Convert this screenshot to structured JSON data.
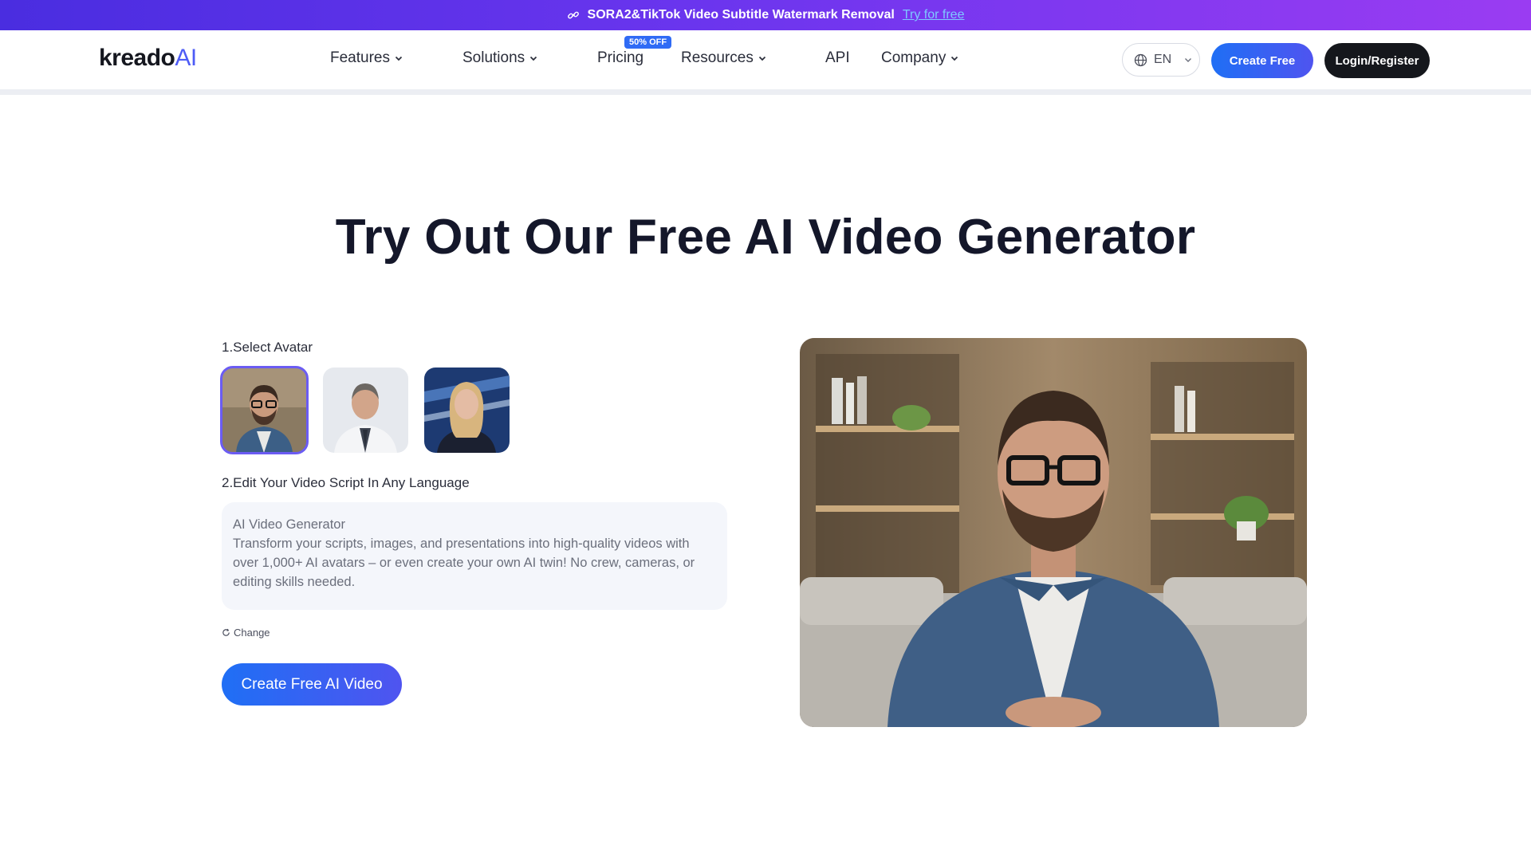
{
  "promo": {
    "text": "SORA2&TikTok Video Subtitle Watermark Removal",
    "link": "Try for free"
  },
  "header": {
    "logo_main": "kreado",
    "logo_ai": "AI",
    "nav": [
      "Features",
      "Solutions",
      "Pricing",
      "Resources",
      "API",
      "Company"
    ],
    "pricing_badge": "50% OFF",
    "language": "EN",
    "create_free": "Create Free",
    "login": "Login/Register"
  },
  "hero": {
    "title": "Try Out Our Free AI Video Generator",
    "step1": "1.Select Avatar",
    "step2": "2.Edit Your Video Script In Any Language",
    "script_title": "AI Video Generator",
    "script_body": "Transform your scripts, images, and presentations into high-quality videos with over 1,000+ AI avatars – or even create your own AI twin! No crew, cameras, or editing skills needed.",
    "change": "Change",
    "cta": "Create Free AI Video"
  },
  "colors": {
    "accent_blue": "#1f6ff5",
    "accent_purple": "#6b5cf3",
    "dark": "#15171c"
  }
}
